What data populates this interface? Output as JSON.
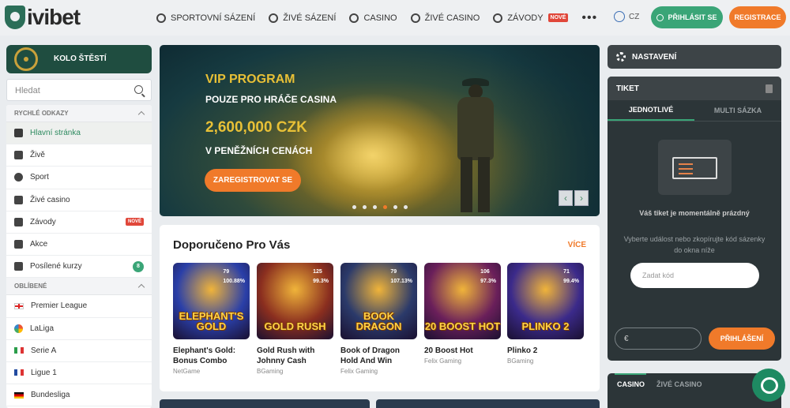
{
  "brand": {
    "name": "ivibet"
  },
  "nav": {
    "items": [
      {
        "label": "SPORTOVNÍ SÁZENÍ",
        "icon": "soccer-ball-icon"
      },
      {
        "label": "ŽIVÉ SÁZENÍ",
        "icon": "live-icon"
      },
      {
        "label": "CASINO",
        "icon": "casino-chip-icon"
      },
      {
        "label": "ŽIVÉ CASINO",
        "icon": "live-casino-icon"
      },
      {
        "label": "ZÁVODY",
        "icon": "races-icon",
        "badge": "NOVÉ"
      }
    ],
    "more": "•••",
    "language": "CZ",
    "login_label": "PŘIHLÁSIT SE",
    "register_label": "REGISTRACE"
  },
  "sidebar": {
    "wheel_label": "KOLO ŠTĚSTÍ",
    "search_placeholder": "Hledat",
    "quick_links_title": "RYCHLÉ ODKAZY",
    "quick_links": [
      {
        "label": "Hlavní stránka",
        "icon": "home-icon",
        "active": true
      },
      {
        "label": "Živě",
        "icon": "broadcast-icon"
      },
      {
        "label": "Sport",
        "icon": "soccer-ball-icon"
      },
      {
        "label": "Živé casino",
        "icon": "live-casino-icon"
      },
      {
        "label": "Závody",
        "icon": "races-icon",
        "badge": "NOVÉ"
      },
      {
        "label": "Akce",
        "icon": "promotions-icon"
      },
      {
        "label": "Posílené kurzy",
        "icon": "boosted-odds-icon",
        "count": "8"
      }
    ],
    "favorites_title": "OBLÍBENÉ",
    "favorites": [
      {
        "label": "Premier League",
        "icon": "england-flag-icon"
      },
      {
        "label": "LaLiga",
        "icon": "laliga-icon"
      },
      {
        "label": "Serie A",
        "icon": "italy-flag-icon"
      },
      {
        "label": "Ligue 1",
        "icon": "france-flag-icon"
      },
      {
        "label": "Bundesliga",
        "icon": "germany-flag-icon"
      }
    ]
  },
  "banner": {
    "title": "VIP PROGRAM",
    "subtitle": "POUZE PRO HRÁČE CASINA",
    "amount": "2,600,000 CZK",
    "amount_caption": "V PENĚŽNÍCH CENÁCH",
    "cta": "ZAREGISTROVAT SE",
    "slides_total": 6,
    "slide_active_index": 3
  },
  "recommended": {
    "title": "Doporučeno Pro Vás",
    "more_label": "VÍCE",
    "games": [
      {
        "name": "Elephant's Gold: Bonus Combo",
        "provider": "NetGame",
        "players": "79",
        "rtp": "100.88%",
        "art": "ELEPHANT'S GOLD",
        "color": "#2a3fa8"
      },
      {
        "name": "Gold Rush with Johnny Cash",
        "provider": "BGaming",
        "players": "125",
        "rtp": "99.3%",
        "art": "GOLD RUSH",
        "color": "#8a2e1f"
      },
      {
        "name": "Book of Dragon Hold And Win",
        "provider": "Felix Gaming",
        "players": "79",
        "rtp": "107.13%",
        "art": "BOOK DRAGON",
        "color": "#2b3a6a"
      },
      {
        "name": "20 Boost Hot",
        "provider": "Felix Gaming",
        "players": "106",
        "rtp": "97.3%",
        "art": "20 BOOST HOT",
        "color": "#6a1f5a"
      },
      {
        "name": "Plinko 2",
        "provider": "BGaming",
        "players": "71",
        "rtp": "99.4%",
        "art": "PLINKO 2",
        "color": "#3b2a8a"
      }
    ]
  },
  "right": {
    "settings_label": "NASTAVENÍ",
    "ticket": {
      "title": "TIKET",
      "tab_single": "JEDNOTLIVÉ",
      "tab_multi": "MULTI SÁZKA",
      "empty": "Váš tiket je momentálně prázdný",
      "desc": "Vyberte událost nebo zkopírujte kód sázenky do okna níže",
      "code_placeholder": "Zadat kód",
      "stake_currency": "€",
      "login_label": "PŘIHLÁŠENÍ"
    },
    "casino_tabs": [
      "CASINO",
      "ŽIVÉ CASINO"
    ]
  },
  "colors": {
    "brand_green": "#3aa577",
    "accent_orange": "#f07a2a",
    "badge_red": "#e0473a"
  }
}
